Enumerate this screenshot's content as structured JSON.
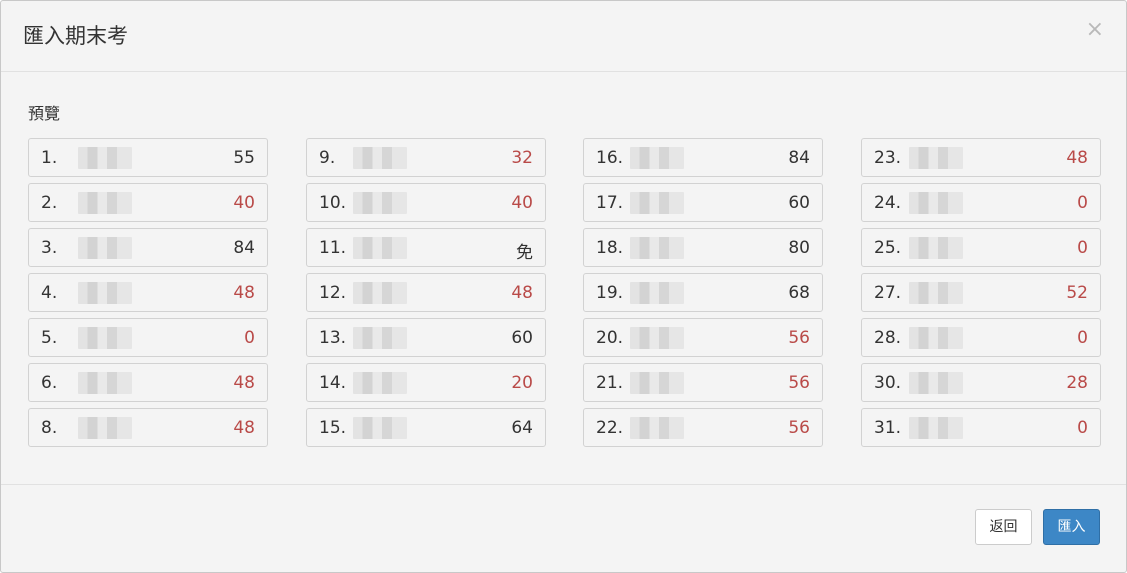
{
  "dialog": {
    "title": "匯入期末考",
    "close_symbol": "×"
  },
  "body": {
    "preview_label": "預覽"
  },
  "columns": [
    [
      {
        "num": "1.",
        "score": "55",
        "fail": false
      },
      {
        "num": "2.",
        "score": "40",
        "fail": true
      },
      {
        "num": "3.",
        "score": "84",
        "fail": false
      },
      {
        "num": "4.",
        "score": "48",
        "fail": true
      },
      {
        "num": "5.",
        "score": "0",
        "fail": true
      },
      {
        "num": "6.",
        "score": "48",
        "fail": true
      },
      {
        "num": "8.",
        "score": "48",
        "fail": true
      }
    ],
    [
      {
        "num": "9.",
        "score": "32",
        "fail": true
      },
      {
        "num": "10.",
        "score": "40",
        "fail": true
      },
      {
        "num": "11.",
        "score": "免",
        "fail": false
      },
      {
        "num": "12.",
        "score": "48",
        "fail": true
      },
      {
        "num": "13.",
        "score": "60",
        "fail": false
      },
      {
        "num": "14.",
        "score": "20",
        "fail": true
      },
      {
        "num": "15.",
        "score": "64",
        "fail": false
      }
    ],
    [
      {
        "num": "16.",
        "score": "84",
        "fail": false
      },
      {
        "num": "17.",
        "score": "60",
        "fail": false
      },
      {
        "num": "18.",
        "score": "80",
        "fail": false
      },
      {
        "num": "19.",
        "score": "68",
        "fail": false
      },
      {
        "num": "20.",
        "score": "56",
        "fail": true
      },
      {
        "num": "21.",
        "score": "56",
        "fail": true
      },
      {
        "num": "22.",
        "score": "56",
        "fail": true
      }
    ],
    [
      {
        "num": "23.",
        "score": "48",
        "fail": true
      },
      {
        "num": "24.",
        "score": "0",
        "fail": true
      },
      {
        "num": "25.",
        "score": "0",
        "fail": true
      },
      {
        "num": "27.",
        "score": "52",
        "fail": true
      },
      {
        "num": "28.",
        "score": "0",
        "fail": true
      },
      {
        "num": "30.",
        "score": "28",
        "fail": true
      },
      {
        "num": "31.",
        "score": "0",
        "fail": true
      }
    ]
  ],
  "footer": {
    "back_label": "返回",
    "import_label": "匯入"
  },
  "colors": {
    "fail_score": "#b94a48",
    "primary_button": "#3d87c6"
  }
}
